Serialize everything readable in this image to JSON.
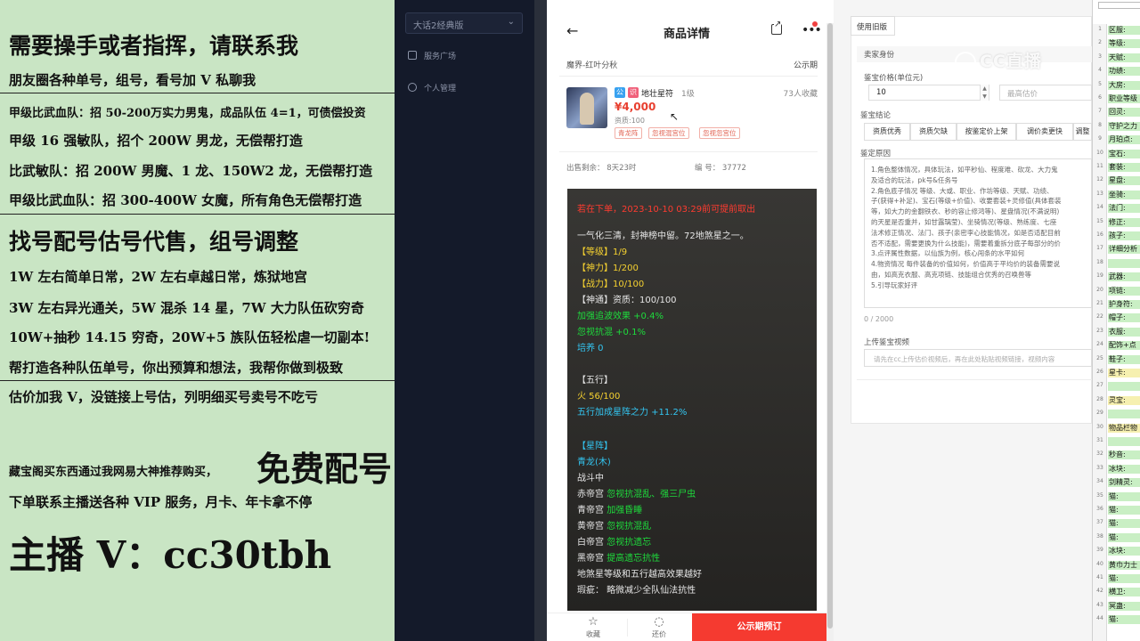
{
  "ad": {
    "line1": "需要操手或者指挥，请联系我",
    "line2": "朋友圈各种单号，组号，看号加 V 私聊我",
    "line3": "甲级比武血队：招 50-200万实力男鬼，成品队伍 4=1，可债偿投资",
    "line4": "甲级 16 强敏队，招个 200W 男龙，无偿帮打造",
    "line5": "比武敏队：招 200W 男魔、1 龙、150W2 龙，无偿帮打造",
    "line6": "甲级比武血队：招 300-400W 女魔，所有角色无偿帮打造",
    "line7": "找号配号估号代售，组号调整",
    "line8": "1W 左右简单日常，2W 左右卓越日常，炼狱地宫",
    "line9": "3W 左右异光通关，5W 混杀 14 星，7W 大力队伍砍穷奇",
    "line10": "10W+抽秒 14.15 穷奇，20W+5 族队伍轻松虐一切副本!",
    "line11": "帮打造各种队伍单号，你出预算和想法，我帮你做到极致",
    "line12": "估价加我 V，没链接上号估，列明细买号卖号不吃亏",
    "line13": "藏宝阁买东西通过我网易大神推荐购买，",
    "line13_big": "免费配号",
    "line14": "下单联系主播送各种 VIP 服务，月卡、年卡拿不停",
    "line15": "主播 V：cc30tbh"
  },
  "sidebar": {
    "version": "大话2经典版",
    "items": [
      {
        "label": "服务广场"
      },
      {
        "label": "个人管理"
      }
    ]
  },
  "phone": {
    "title": "商品详情",
    "server": "魔界-红叶分秋",
    "publicity": "公示期",
    "item": {
      "badge1": "公",
      "badge2": "识",
      "name": "地壮星符",
      "level": "1级",
      "favorites": "73人收藏",
      "price": "¥4,000",
      "aptitude": "资质:100",
      "tags": [
        "青龙阵",
        "忽视混宫位",
        "忽视忽宫位"
      ]
    },
    "sale_remaining": "出售剩余：  8天23时",
    "item_no": "编  号：  37772",
    "stats": {
      "notice": "若在下单，2023-10-10 03:29前可提前取出",
      "intro": "一气化三清，封神榜中留。72地煞星之一。",
      "level": "【等级】1/9",
      "divine": "【神力】1/200",
      "battle": "【战力】10/100",
      "shentong": "【神通】资质：100/100",
      "bonus1": "加强追波效果 +0.4%",
      "bonus2": "忽视抗混 +0.1%",
      "cultivate": "培养 0",
      "wuxing_head": "【五行】",
      "fire": "火 56/100",
      "wuxing_bonus": "五行加成星阵之力 +11.2%",
      "xingzhen_head": "【星阵】",
      "qinglong": "青龙(木)",
      "in_battle": "战斗中",
      "palaces": [
        {
          "name": "赤帝宫",
          "value": "忽视抗混乱、强三尸虫"
        },
        {
          "name": "青帝宫",
          "value": "加强昏睡"
        },
        {
          "name": "黄帝宫",
          "value": "忽视抗混乱"
        },
        {
          "name": "白帝宫",
          "value": "忽视抗遗忘"
        },
        {
          "name": "黑帝宫",
          "value": "提高遗忘抗性"
        }
      ],
      "note": "地煞星等级和五行越高效果越好",
      "flaw": "瑕疵：  略微减少全队仙法抗性"
    },
    "bottom": {
      "fav": "收藏",
      "bargain": "还价",
      "buy": "公示期预订"
    }
  },
  "appraisal": {
    "tab": "使用旧版",
    "seller": "卖家身份",
    "price_label": "鉴宝价格(单位元)",
    "price_value": "10",
    "max_placeholder": "最高估价",
    "conclusion_label": "鉴宝结论",
    "buttons": [
      "资质优秀",
      "资质欠缺",
      "按鉴定价上架",
      "调价卖更快",
      "调整"
    ],
    "reason_label": "鉴定原因",
    "reason_lines": [
      "1.角色整体情况，具体玩法，如平秒仙、程度难、砍龙、大力鬼",
      "及适合的玩法，pk号&任务号",
      "2.角色底子情况 等级、大或、职业、作坊等级、天赋、功绩、",
      "子(获得+补足)、宝石(等级+价值)、收要套装+灵修值(具体套装",
      "等，如大力的金翻铁衣、秒的容止修鸿等)、星盘情况(不满说明)",
      "的天星是否重并，如甘露璃莹)、坐骑情况(等级、熟练度、七座",
      "法术修正情况、法门、孩子(亲密李心技能情况，如是否适配目前",
      "否不适配，需要更换为什么技能)，需要着重拆分底子每部分的价",
      "3.点评属性数据，以仙族为例，核心闯条的水平如何",
      "4.物资情况 每件装备的价值如何，价值高于平均价的装备需要说",
      "由，如高克衣服、高克项链、技能组合优秀的召唤兽等",
      "5.引导玩家好评"
    ],
    "char_count": "0 / 2000",
    "video_label": "上传鉴宝视频",
    "video_placeholder": "请先在cc上传估价视频后，再在此处粘贴视频链接，视频内容"
  },
  "watermark": "CC直播",
  "sheet": {
    "rows": [
      {
        "n": "1",
        "text": "区服:",
        "style": "g"
      },
      {
        "n": "2",
        "text": "等级:",
        "style": "g"
      },
      {
        "n": "3",
        "text": "天赋:",
        "style": "g"
      },
      {
        "n": "4",
        "text": "功绩:",
        "style": "g"
      },
      {
        "n": "5",
        "text": "大房:",
        "style": "g"
      },
      {
        "n": "6",
        "text": "职业等级",
        "style": "g"
      },
      {
        "n": "7",
        "text": "回灵:",
        "style": "g"
      },
      {
        "n": "8",
        "text": "守护之力",
        "style": "g"
      },
      {
        "n": "9",
        "text": "月珀点:",
        "style": "g"
      },
      {
        "n": "10",
        "text": "宝石:",
        "style": "g"
      },
      {
        "n": "11",
        "text": "套装:",
        "style": "g"
      },
      {
        "n": "12",
        "text": "星盘:",
        "style": "g"
      },
      {
        "n": "13",
        "text": "坐骑:",
        "style": "g"
      },
      {
        "n": "14",
        "text": "法门:",
        "style": "g"
      },
      {
        "n": "15",
        "text": "修正:",
        "style": "g"
      },
      {
        "n": "16",
        "text": "孩子:",
        "style": "g"
      },
      {
        "n": "17",
        "text": "详细分析",
        "style": "g"
      },
      {
        "n": "18",
        "text": "",
        "style": "g"
      },
      {
        "n": "19",
        "text": "武器:",
        "style": "g"
      },
      {
        "n": "20",
        "text": "项链:",
        "style": "g"
      },
      {
        "n": "21",
        "text": "护身符:",
        "style": "g"
      },
      {
        "n": "22",
        "text": "帽子:",
        "style": "g"
      },
      {
        "n": "23",
        "text": "衣服:",
        "style": "g"
      },
      {
        "n": "24",
        "text": "配饰+点",
        "style": "g"
      },
      {
        "n": "25",
        "text": "鞋子:",
        "style": "g"
      },
      {
        "n": "26",
        "text": "星卡:",
        "style": "y"
      },
      {
        "n": "27",
        "text": "",
        "style": "g"
      },
      {
        "n": "28",
        "text": "灵宝:",
        "style": "y"
      },
      {
        "n": "29",
        "text": "",
        "style": "g"
      },
      {
        "n": "30",
        "text": "物品栏物",
        "style": "y"
      },
      {
        "n": "31",
        "text": "",
        "style": "g"
      },
      {
        "n": "32",
        "text": "秒音:",
        "style": "g"
      },
      {
        "n": "33",
        "text": "冰块:",
        "style": "g"
      },
      {
        "n": "34",
        "text": "剑精灵:",
        "style": "g"
      },
      {
        "n": "35",
        "text": "猫:",
        "style": "g"
      },
      {
        "n": "36",
        "text": "猫:",
        "style": "g"
      },
      {
        "n": "37",
        "text": "猫:",
        "style": "g"
      },
      {
        "n": "38",
        "text": "猫:",
        "style": "g"
      },
      {
        "n": "39",
        "text": "冰块:",
        "style": "g"
      },
      {
        "n": "40",
        "text": "黄巾力士",
        "style": "g"
      },
      {
        "n": "41",
        "text": "猫:",
        "style": "g"
      },
      {
        "n": "42",
        "text": "横卫:",
        "style": "g"
      },
      {
        "n": "43",
        "text": "冥蛊:",
        "style": "g"
      },
      {
        "n": "44",
        "text": "猫:",
        "style": "g"
      }
    ]
  }
}
